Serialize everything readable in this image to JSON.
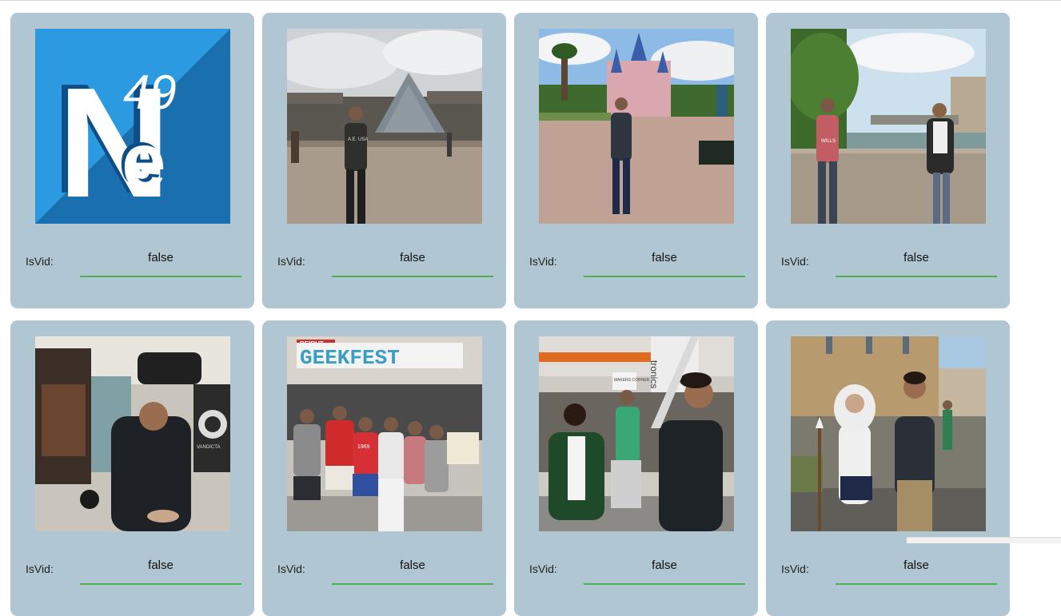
{
  "cards": [
    {
      "image": "ne49-logo",
      "label": "IsVid:",
      "value": "false",
      "logo_big": "N",
      "logo_e": "e",
      "logo_num": "49"
    },
    {
      "image": "photo-louvre-pyramid",
      "label": "IsVid:",
      "value": "false",
      "shirt_text": "A.E. USA"
    },
    {
      "image": "photo-disneyland-castle",
      "label": "IsVid:",
      "value": "false"
    },
    {
      "image": "photo-paris-river-bridge",
      "label": "IsVid:",
      "value": "false",
      "shirt_text": "WILLS"
    },
    {
      "image": "photo-vr-headset",
      "label": "IsVid:",
      "value": "false",
      "banner_text": "VANDICTA"
    },
    {
      "image": "photo-geekfest-group",
      "label": "IsVid:",
      "value": "false",
      "sign_text": "GEEKFEST",
      "sign_top": "BEIRUT",
      "shirt_text": "1969"
    },
    {
      "image": "photo-cosplay-sword",
      "label": "IsVid:",
      "value": "false",
      "sign_text": "MAKERS CORNER",
      "sign_text_2": "tronics"
    },
    {
      "image": "photo-cosplay-feathers",
      "label": "IsVid:",
      "value": "false"
    }
  ],
  "colors": {
    "card_bg": "#b0c6d2",
    "underline": "#4caf50",
    "logo_blue": "#1f7fc0",
    "logo_light_blue": "#3aa7e6"
  }
}
